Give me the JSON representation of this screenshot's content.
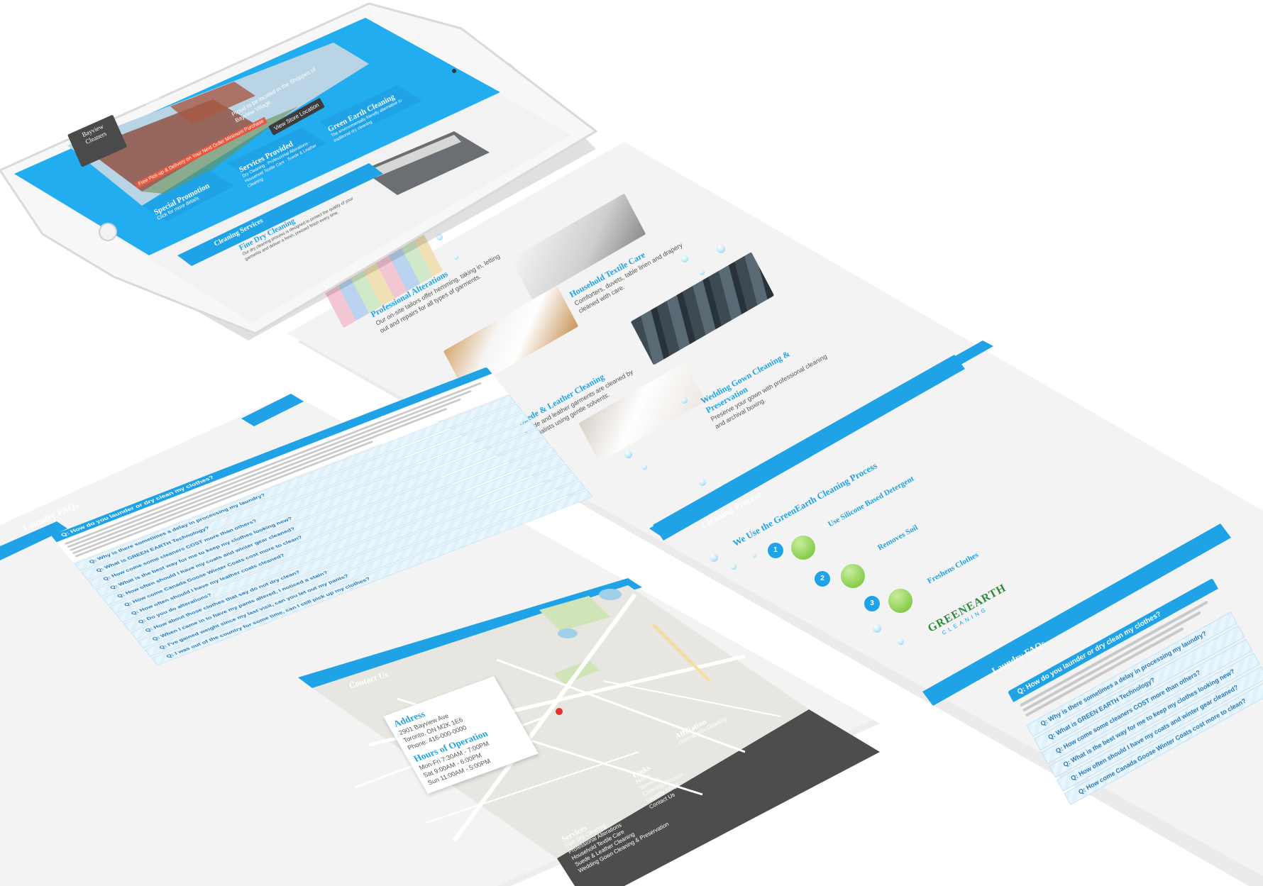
{
  "site": {
    "brand_line1": "Bayview",
    "brand_line2": "Cleaners",
    "nav": [
      "Home",
      "Services",
      "Cleaning Process",
      "Laundry FAQs",
      "Contact Us"
    ],
    "hero_caption": "Proud to be located in the Shoppes of Bayview Village",
    "hero_button": "View Store Location",
    "promo_banner": "Free Pick-up & Delivery on Your Next Order Minimum Purchase",
    "cards": [
      {
        "title": "Special Promotion",
        "text": "Click for more details"
      },
      {
        "title": "Services Provided",
        "text": "Dry Cleaning · Professional Alterations · Household Textile Care · Suede & Leather Cleaning"
      },
      {
        "title": "Green Earth Cleaning",
        "text": "The environmentally friendly alternative to traditional dry cleaning"
      }
    ]
  },
  "services": {
    "heading": "Cleaning Services",
    "items": [
      {
        "title": "Fine Dry Cleaning",
        "text": "Our dry cleaning process is designed to protect the quality of your garments and deliver a fresh, pressed finish every time."
      },
      {
        "title": "Professional Alterations",
        "text": "Our on-site tailors offer hemming, taking in, letting out and repairs for all types of garments."
      },
      {
        "title": "Household Textile Care",
        "text": "Comforters, duvets, table linen and drapery cleaned with care."
      },
      {
        "title": "Suede & Leather Cleaning",
        "text": "Suede and leather garments are cleaned by specialists using gentle solvents."
      },
      {
        "title": "Wedding Gown Cleaning & Preservation",
        "text": "Preserve your gown with professional cleaning and archival boxing."
      }
    ]
  },
  "process": {
    "heading": "Cleaning Process",
    "title": "We Use the GreenEarth Cleaning Process",
    "steps": [
      {
        "num": "1",
        "title": "Use Silicone Based Detergent"
      },
      {
        "num": "2",
        "title": "Removes Soil"
      },
      {
        "num": "3",
        "title": "Freshens Clothes"
      }
    ],
    "logo_main": "GREENEARTH",
    "logo_sub": "CLEANING"
  },
  "faq": {
    "heading": "Laundry FAQs",
    "open_question": "Q: How do you launder or dry clean my clothes?",
    "questions": [
      "Q: Why is there sometimes a delay in processing my laundry?",
      "Q: What is GREEN EARTH Technology?",
      "Q: How come some cleaners COST more than others?",
      "Q: What is the best way for me to keep my clothes looking new?",
      "Q: How often should I have my coats and winter gear cleaned?",
      "Q: How come Canada Goose Winter Coats cost more to clean?",
      "Q: How often should I have my leather coats cleaned?",
      "Q: Do you do alterations?",
      "Q: How about those clothes that say do not dry clean?",
      "Q: When I came in to have my pants altered, I noticed a stain?",
      "Q: I've gained weight since my last visit, can you let out my pants?",
      "Q: I was out of the country for some time, can I still pick up my clothes?"
    ]
  },
  "contact": {
    "heading": "Contact Us",
    "address_title": "Address",
    "address_lines": [
      "2901 Bayview Ave",
      "Toronto, ON M2K 1E6",
      "Phone: 416-000-0000"
    ],
    "hours_title": "Hours of Operation",
    "hours_lines": [
      "Mon-Fri 7:30AM - 7:00PM",
      "Sat 9:00AM - 6:00PM",
      "Sun 11:00AM - 5:00PM"
    ]
  },
  "footer": {
    "services_title": "Services",
    "services_items": [
      "Fine Dry Cleaning",
      "Professional Alterations",
      "Household Textile Care",
      "Suede & Leather Cleaning",
      "Wedding Gown Cleaning & Preservation"
    ],
    "links_title": "Links",
    "links_items": [
      "Home",
      "Services",
      "Cleaning Process",
      "Laundry FAQs",
      "Contact Us"
    ],
    "affiliation_title": "Affiliation",
    "affiliation_items": [
      "GreenEarth Cleaning"
    ]
  },
  "colors": {
    "accent": "#1fa3e6",
    "green": "#6cbf2b",
    "footer": "#4d4d4d"
  }
}
